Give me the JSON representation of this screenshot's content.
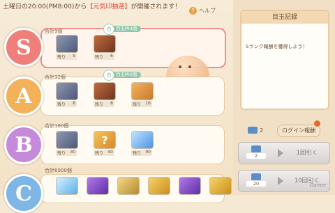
{
  "banner": {
    "text_before": "土曜日の20:00(PM8:00)から",
    "highlight": "【元気印抽選】",
    "text_after": "が開催されます！"
  },
  "help": {
    "label": "ヘルプ"
  },
  "rows": [
    {
      "rank": "S",
      "color": "#ef7f7a",
      "total": "合計9個",
      "tag": "目玉枠3個",
      "items": [
        {
          "type": "hero",
          "label": "残り",
          "count": "5"
        },
        {
          "type": "chest",
          "label": "残り",
          "count": "6"
        }
      ]
    },
    {
      "rank": "A",
      "color": "#f3b15a",
      "total": "合計32個",
      "tag": "目玉枠2個",
      "items": [
        {
          "type": "hero",
          "label": "残り",
          "count": "8"
        },
        {
          "type": "chest",
          "label": "残り",
          "count": "8"
        },
        {
          "type": "book",
          "label": "残り",
          "count": "16"
        }
      ]
    },
    {
      "rank": "B",
      "color": "#c58ad9",
      "total": "合計160個",
      "tag": "",
      "items": [
        {
          "type": "hero",
          "label": "残り",
          "count": "30"
        },
        {
          "type": "mystery",
          "label": "残り",
          "count": "40"
        },
        {
          "type": "gem",
          "label": "残り",
          "count": "90"
        }
      ]
    },
    {
      "rank": "C",
      "color": "#7fb6e6",
      "total": "合計6000個",
      "tag": "",
      "items": [
        {
          "type": "crystal",
          "label": "",
          "count": ""
        },
        {
          "type": "potion",
          "label": "",
          "count": ""
        },
        {
          "type": "scroll",
          "label": "",
          "count": ""
        },
        {
          "type": "medal",
          "label": "",
          "count": ""
        },
        {
          "type": "potion",
          "label": "",
          "count": ""
        },
        {
          "type": "medal",
          "label": "",
          "count": ""
        }
      ]
    }
  ],
  "record": {
    "title": "目玉記録",
    "message": "Sランク報酬を獲得しよう！"
  },
  "tickets": {
    "count": "2",
    "login_label": "ログイン報酬"
  },
  "pulls": [
    {
      "cost": "2",
      "label": "1回引く"
    },
    {
      "cost": "20",
      "label": "10回引く"
    }
  ],
  "watermark": "Gamer"
}
